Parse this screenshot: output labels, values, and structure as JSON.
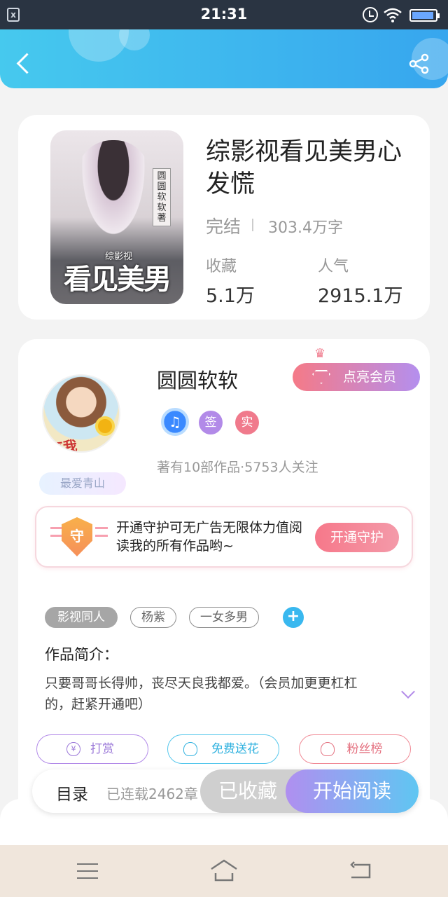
{
  "status_bar": {
    "time": "21:31",
    "left_icon": "close-app-icon",
    "icons": [
      "alarm-icon",
      "wifi-icon",
      "battery-icon"
    ]
  },
  "header": {
    "back_icon": "back-arrow-icon",
    "share_icon": "share-icon",
    "color_start": "#46c9ee",
    "color_end": "#37a6ee"
  },
  "book": {
    "cover": {
      "title": "看见美男",
      "subtitle": "综影视",
      "side_label": "圆圆软软著"
    },
    "title": "综影视看见美男心发慌",
    "status": "完结",
    "words": "303.4万字",
    "stats": [
      {
        "label": "收藏",
        "value": "5.1万"
      },
      {
        "label": "人气",
        "value": "2915.1万"
      }
    ]
  },
  "author": {
    "name": "圆圆软软",
    "avatar_text": "有我",
    "fav_tag": "最爱青山",
    "vip_label": "点亮会员",
    "badges": [
      {
        "icon": "music-badge-icon",
        "text": "♫"
      },
      {
        "icon": "sign-badge-icon",
        "text": "签"
      },
      {
        "icon": "real-badge-icon",
        "text": "实"
      }
    ],
    "meta": "著有10部作品·5753人关注"
  },
  "guard": {
    "shield_text": "守",
    "text": "开通守护可无广告无限体力值阅读我的所有作品哟~",
    "button": "开通守护"
  },
  "tags": [
    "影视同人",
    "杨紫",
    "一女多男"
  ],
  "tag_add": "+",
  "intro": {
    "title": "作品简介：",
    "text": "只要哥哥长得帅，丧尽天良我都爱。（会员加更更杠杠的，赶紧开通吧）"
  },
  "actions": [
    {
      "label": "打赏",
      "icon": "yen-icon",
      "icon_text": "¥"
    },
    {
      "label": "免费送花",
      "icon": "flower-icon",
      "icon_text": ""
    },
    {
      "label": "粉丝榜",
      "icon": "user-rank-icon",
      "icon_text": ""
    }
  ],
  "bottom_bar": {
    "catalog": "目录",
    "catalog_status": "已连载2462章",
    "collected": "已收藏",
    "read": "开始阅读"
  },
  "nav": [
    "menu-icon",
    "home-icon",
    "back-icon"
  ],
  "colors": {
    "accent_pink": "#f6788a",
    "accent_purple": "#b28ae8",
    "accent_blue": "#39b8ef"
  }
}
